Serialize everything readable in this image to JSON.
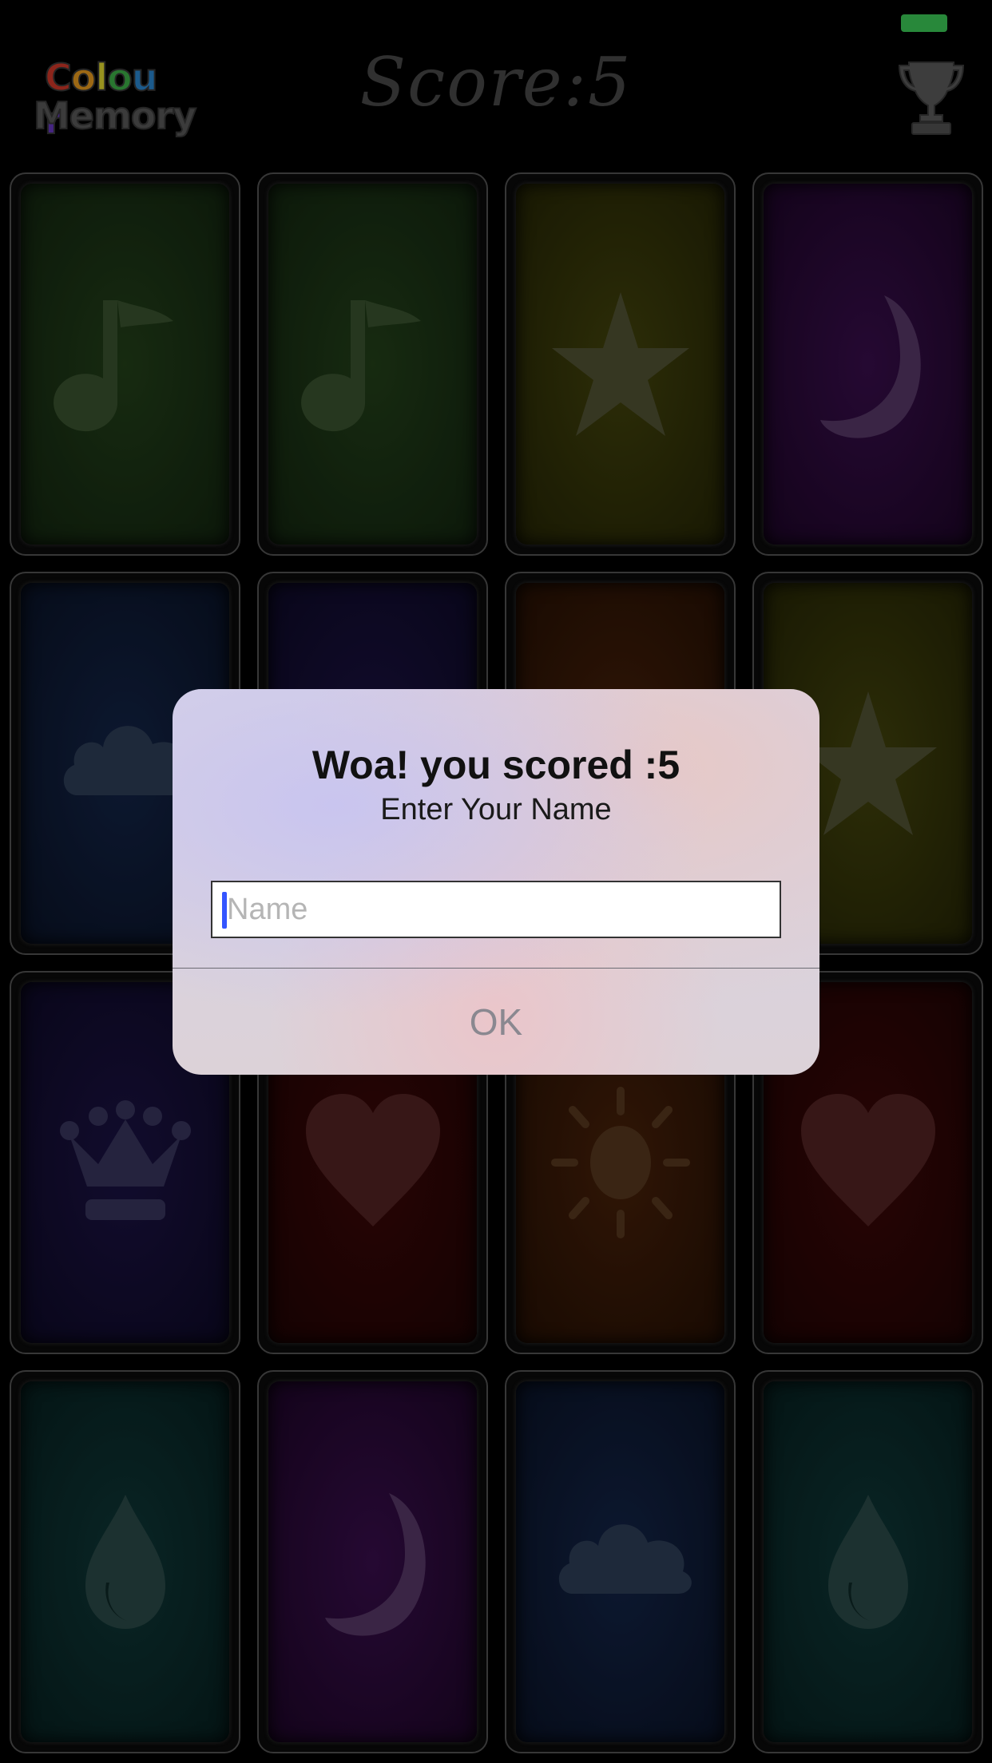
{
  "status_bar": {
    "battery_color": "#3ed15a"
  },
  "header": {
    "logo": {
      "line1": [
        "C",
        "o",
        "l",
        "o",
        "u",
        "r"
      ],
      "line1_colors": [
        "#d83a2a",
        "#f0a020",
        "#e8e030",
        "#3fb64a",
        "#2a8ad8",
        "#6a3ac8"
      ],
      "line2": "Memory"
    },
    "score_text": "Score:5",
    "trophy_icon": "trophy-icon"
  },
  "cards": [
    {
      "icon": "music-note-icon",
      "color": "green"
    },
    {
      "icon": "music-note-icon",
      "color": "green"
    },
    {
      "icon": "star-icon",
      "color": "yellow"
    },
    {
      "icon": "moon-icon",
      "color": "purple"
    },
    {
      "icon": "cloud-icon",
      "color": "blue"
    },
    {
      "icon": "card-icon",
      "color": "indigo"
    },
    {
      "icon": "card-icon",
      "color": "orange"
    },
    {
      "icon": "star-icon",
      "color": "yellow"
    },
    {
      "icon": "crown-icon",
      "color": "indigo"
    },
    {
      "icon": "heart-icon",
      "color": "red"
    },
    {
      "icon": "sun-icon",
      "color": "orange"
    },
    {
      "icon": "heart-icon",
      "color": "red"
    },
    {
      "icon": "drop-icon",
      "color": "teal"
    },
    {
      "icon": "moon-icon",
      "color": "purple"
    },
    {
      "icon": "cloud-icon",
      "color": "blue"
    },
    {
      "icon": "drop-icon",
      "color": "teal"
    }
  ],
  "palette": {
    "green": "#1f3a12",
    "yellow": "#3b3c0a",
    "purple": "#2e0a3e",
    "blue": "#0e1d3e",
    "indigo": "#150d38",
    "orange": "#3b1a06",
    "red": "#320606",
    "teal": "#0b2c2c"
  },
  "dialog": {
    "title": "Woa! you scored :5",
    "message": "Enter Your Name",
    "input_placeholder": "Name",
    "input_value": "",
    "ok_label": "OK"
  }
}
